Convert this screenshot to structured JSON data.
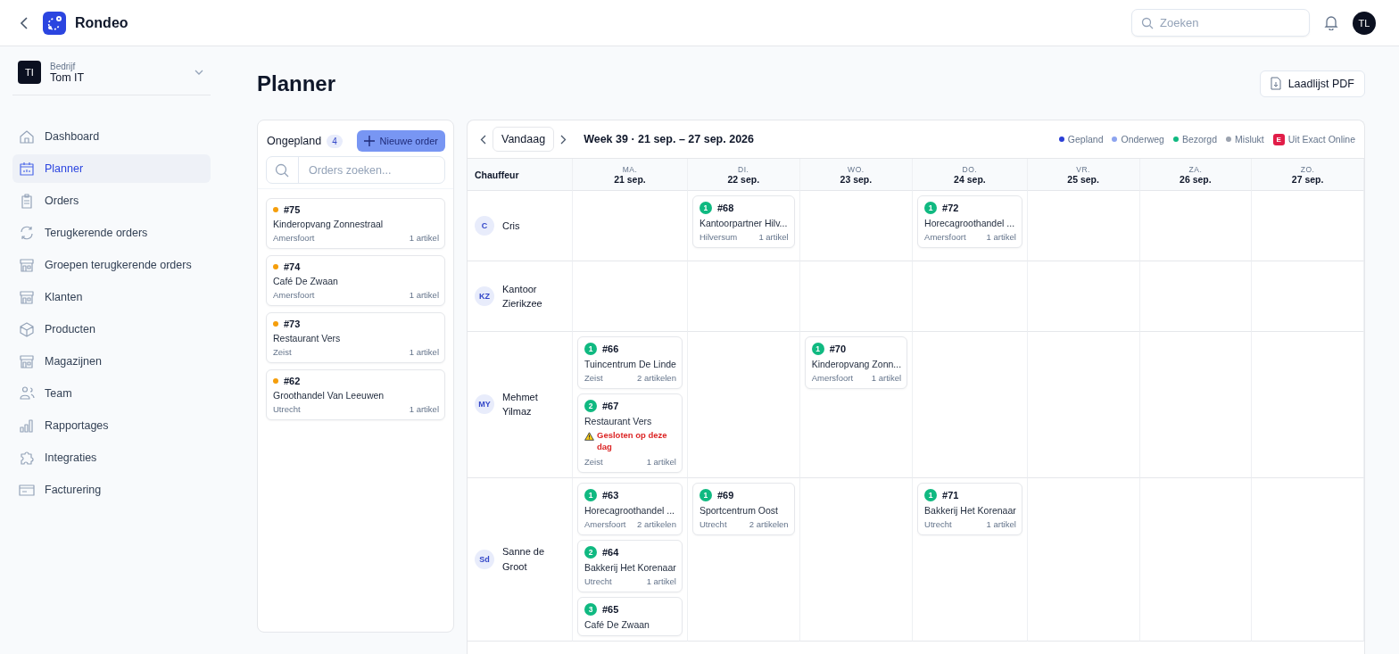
{
  "app": {
    "name": "Rondeo"
  },
  "topbar": {
    "search": {
      "placeholder": "Zoeken"
    },
    "user_initials": "TL"
  },
  "company": {
    "initials": "TI",
    "label": "Bedrijf",
    "name": "Tom IT"
  },
  "sidebar": {
    "items": [
      {
        "label": "Dashboard",
        "selected": false
      },
      {
        "label": "Planner",
        "selected": true
      },
      {
        "label": "Orders",
        "selected": false
      },
      {
        "label": "Terugkerende orders",
        "selected": false
      },
      {
        "label": "Groepen terugkerende orders",
        "selected": false
      },
      {
        "label": "Klanten",
        "selected": false
      },
      {
        "label": "Producten",
        "selected": false
      },
      {
        "label": "Magazijnen",
        "selected": false
      },
      {
        "label": "Team",
        "selected": false
      },
      {
        "label": "Rapportages",
        "selected": false
      },
      {
        "label": "Integraties",
        "selected": false
      },
      {
        "label": "Facturering",
        "selected": false
      }
    ]
  },
  "page": {
    "title": "Planner",
    "export_button": "Laadlijst PDF"
  },
  "unplanned": {
    "title": "Ongepland",
    "count": "4",
    "new_button": "Nieuwe order",
    "search": {
      "placeholder": "Orders zoeken..."
    },
    "orders": [
      {
        "id": "#75",
        "color": "#f59e0b",
        "name": "Kinderopvang Zonnestraal",
        "city": "Amersfoort",
        "items": "1 artikel"
      },
      {
        "id": "#74",
        "color": "#f59e0b",
        "name": "Café De Zwaan",
        "city": "Amersfoort",
        "items": "1 artikel"
      },
      {
        "id": "#73",
        "color": "#f59e0b",
        "name": "Restaurant Vers",
        "city": "Zeist",
        "items": "1 artikel"
      },
      {
        "id": "#62",
        "color": "#f59e0b",
        "name": "Groothandel Van Leeuwen",
        "city": "Utrecht",
        "items": "1 artikel"
      }
    ]
  },
  "calendar": {
    "today_button": "Vandaag",
    "week_label": "Week 39 · 21 sep. – 27 sep. 2026",
    "legend": [
      {
        "kind": "dot",
        "label": "Gepland",
        "color": "#2b3fd6"
      },
      {
        "kind": "dot",
        "label": "Onderweg",
        "color": "#8da4ef"
      },
      {
        "kind": "dot",
        "label": "Bezorgd",
        "color": "#10b981"
      },
      {
        "kind": "dot",
        "label": "Mislukt",
        "color": "#9ca3af"
      },
      {
        "kind": "badge",
        "label": "Uit Exact Online",
        "mark": "E",
        "color": "#e11d48"
      }
    ],
    "driver_header": "Chauffeur",
    "days": [
      {
        "weekday": "MA.",
        "date": "21 sep."
      },
      {
        "weekday": "DI.",
        "date": "22 sep."
      },
      {
        "weekday": "WO.",
        "date": "23 sep."
      },
      {
        "weekday": "DO.",
        "date": "24 sep."
      },
      {
        "weekday": "VR.",
        "date": "25 sep."
      },
      {
        "weekday": "ZA.",
        "date": "26 sep."
      },
      {
        "weekday": "ZO.",
        "date": "27 sep."
      }
    ],
    "drivers": [
      {
        "initials": "C",
        "name": "Cris",
        "cells": [
          [],
          [
            {
              "seq": "1",
              "color": "#10b981",
              "id": "#68",
              "name": "Kantoorpartner Hilv...",
              "city": "Hilversum",
              "items": "1 artikel"
            }
          ],
          [],
          [
            {
              "seq": "1",
              "color": "#10b981",
              "id": "#72",
              "name": "Horecagroothandel ...",
              "city": "Amersfoort",
              "items": "1 artikel"
            }
          ],
          [],
          [],
          []
        ]
      },
      {
        "initials": "KZ",
        "name": "Kantoor Zierikzee",
        "cells": [
          [],
          [],
          [],
          [],
          [],
          [],
          []
        ]
      },
      {
        "initials": "MY",
        "name": "Mehmet Yilmaz",
        "cells": [
          [
            {
              "seq": "1",
              "color": "#10b981",
              "id": "#66",
              "name": "Tuincentrum De Linde",
              "city": "Zeist",
              "items": "2 artikelen"
            },
            {
              "seq": "2",
              "color": "#10b981",
              "id": "#67",
              "name": "Restaurant Vers",
              "warning": "Gesloten op deze dag",
              "city": "Zeist",
              "items": "1 artikel"
            }
          ],
          [],
          [
            {
              "seq": "1",
              "color": "#10b981",
              "id": "#70",
              "name": "Kinderopvang Zonn...",
              "city": "Amersfoort",
              "items": "1 artikel"
            }
          ],
          [],
          [],
          [],
          []
        ]
      },
      {
        "initials": "Sd",
        "name": "Sanne de Groot",
        "cells": [
          [
            {
              "seq": "1",
              "color": "#10b981",
              "id": "#63",
              "name": "Horecagroothandel ...",
              "city": "Amersfoort",
              "items": "2 artikelen"
            },
            {
              "seq": "2",
              "color": "#10b981",
              "id": "#64",
              "name": "Bakkerij Het Korenaar",
              "city": "Utrecht",
              "items": "1 artikel"
            },
            {
              "seq": "3",
              "color": "#10b981",
              "id": "#65",
              "name": "Café De Zwaan"
            }
          ],
          [
            {
              "seq": "1",
              "color": "#10b981",
              "id": "#69",
              "name": "Sportcentrum Oost",
              "city": "Utrecht",
              "items": "2 artikelen"
            }
          ],
          [],
          [
            {
              "seq": "1",
              "color": "#10b981",
              "id": "#71",
              "name": "Bakkerij Het Korenaar",
              "city": "Utrecht",
              "items": "1 artikel"
            }
          ],
          [],
          [],
          []
        ]
      }
    ]
  }
}
